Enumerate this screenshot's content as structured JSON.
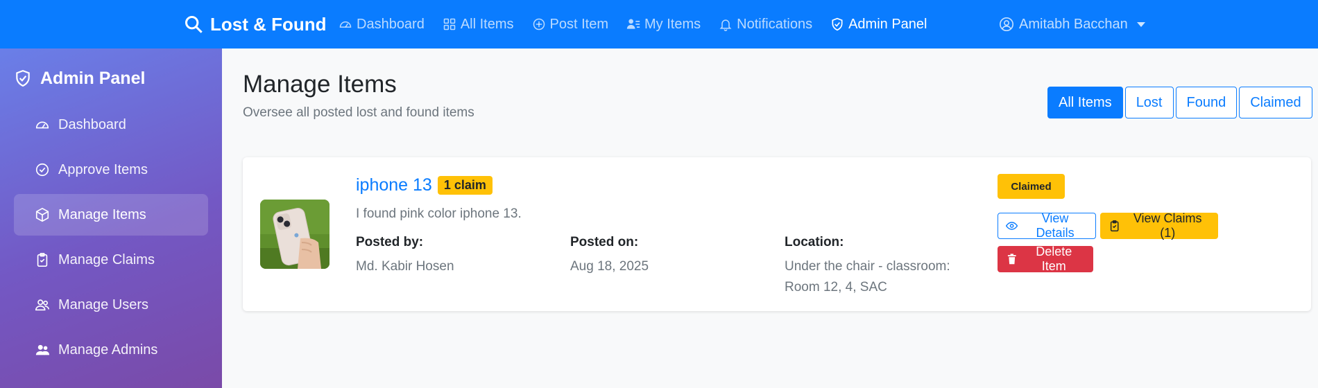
{
  "navbar": {
    "brand": "Lost & Found",
    "links": [
      {
        "label": "Dashboard",
        "icon": "speedometer-icon"
      },
      {
        "label": "All Items",
        "icon": "grid-icon"
      },
      {
        "label": "Post Item",
        "icon": "plus-circle-icon"
      },
      {
        "label": "My Items",
        "icon": "person-lines-icon"
      },
      {
        "label": "Notifications",
        "icon": "bell-icon"
      },
      {
        "label": "Admin Panel",
        "icon": "shield-check-icon",
        "active": true
      }
    ],
    "user": "Amitabh Bacchan"
  },
  "sidebar": {
    "title": "Admin Panel",
    "items": [
      {
        "label": "Dashboard",
        "icon": "speedometer-icon"
      },
      {
        "label": "Approve Items",
        "icon": "check-circle-icon"
      },
      {
        "label": "Manage Items",
        "icon": "box-icon",
        "active": true
      },
      {
        "label": "Manage Claims",
        "icon": "clipboard-check-icon"
      },
      {
        "label": "Manage Users",
        "icon": "people-icon"
      },
      {
        "label": "Manage Admins",
        "icon": "people-fill-icon"
      }
    ]
  },
  "main": {
    "title": "Manage Items",
    "subtitle": "Oversee all posted lost and found items",
    "filters": [
      "All Items",
      "Lost",
      "Found",
      "Claimed"
    ],
    "active_filter": "All Items"
  },
  "item": {
    "title": "iphone 13",
    "claim_count": "1 claim",
    "description": "I found pink color iphone 13.",
    "posted_by_label": "Posted by:",
    "posted_by": "Md. Kabir Hosen",
    "posted_on_label": "Posted on:",
    "posted_on": "Aug 18, 2025",
    "location_label": "Location:",
    "location": "Under the chair - classroom: Room 12, 4, SAC",
    "status": "Claimed",
    "view_details": "View Details",
    "view_claims": "View Claims (1)",
    "delete": "Delete Item"
  },
  "colors": {
    "primary": "#0a7cff",
    "warning": "#ffc107",
    "danger": "#dc3545",
    "sidebar_start": "#6a7fe8",
    "sidebar_end": "#7a4aa8"
  }
}
